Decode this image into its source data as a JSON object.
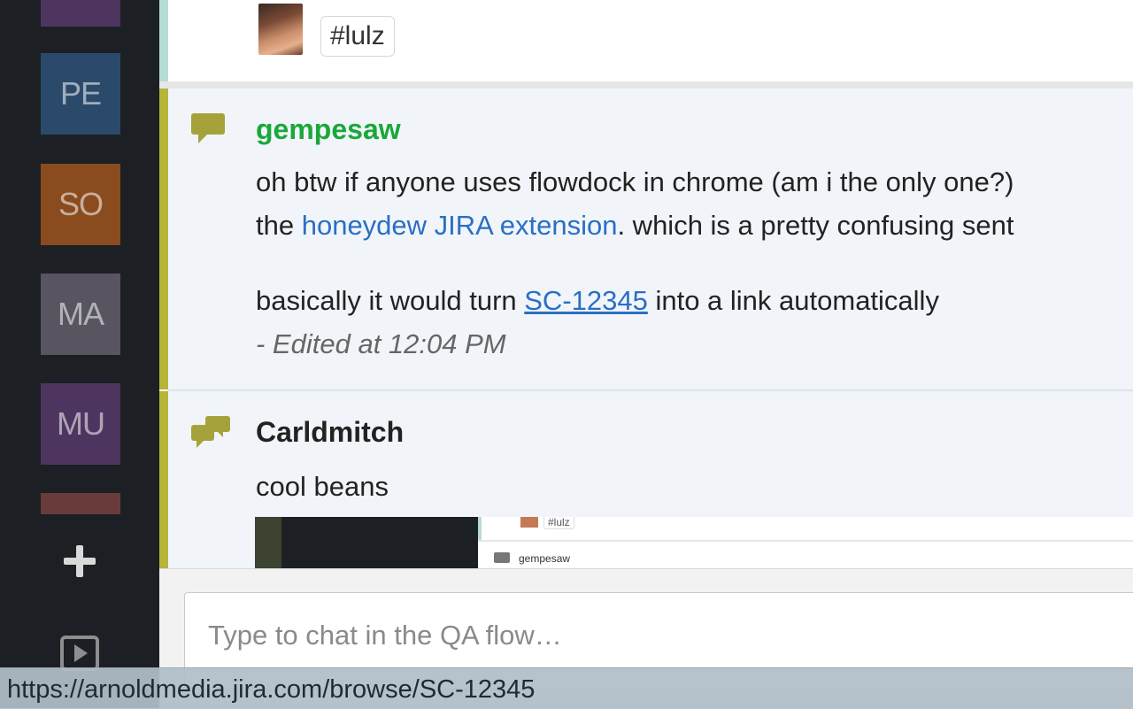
{
  "sidebar": {
    "tiles": [
      {
        "label": "PE",
        "color": "#2b4a6b"
      },
      {
        "label": "SO",
        "color": "#8a4b1f"
      },
      {
        "label": "MA",
        "color": "#585460"
      },
      {
        "label": "MU",
        "color": "#4e3560"
      }
    ],
    "partial_tile_top_color": "#4e3560",
    "partial_tile_bottom_color": "#6a3b3b",
    "add_icon": "plus-icon",
    "play_icon": "play-icon"
  },
  "messages": {
    "top": {
      "tag": "#lulz"
    },
    "msg1": {
      "author": "gempesaw",
      "author_color": "#1aa83a",
      "line1": "oh btw if anyone uses flowdock in chrome (am i the only one?)",
      "line2_pre": "the ",
      "line2_link": "honeydew JIRA extension",
      "line2_post": ". which is a pretty confusing sent",
      "line3_pre": "basically it would turn ",
      "line3_link": "SC-12345",
      "line3_post": " into a link automatically",
      "edited": "- Edited at 12:04 PM",
      "icon": "speech-bubble-icon"
    },
    "msg2": {
      "author": "Carldmitch",
      "author_color": "#222222",
      "text": "cool beans",
      "icon": "speech-bubbles-icon",
      "preview": {
        "tag": "#lulz",
        "name": "gempesaw"
      }
    }
  },
  "composer": {
    "placeholder": "Type to chat in the QA flow…"
  },
  "status_bar": {
    "url": "https://arnoldmedia.jira.com/browse/SC-12345"
  }
}
